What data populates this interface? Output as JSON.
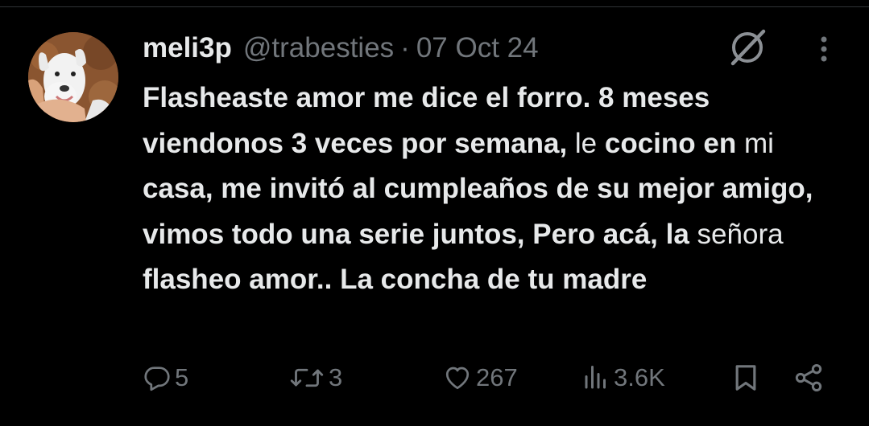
{
  "tweet": {
    "author": {
      "display_name": "meli3p",
      "handle": "@trabesties",
      "avatar_icon": "puppy-avatar"
    },
    "separator": "·",
    "date": "07 Oct 24",
    "text_segments": [
      {
        "text": "Flasheaste amor me dice el forro. 8 meses viendonos 3 veces por semana, ",
        "bold": true
      },
      {
        "text": "le ",
        "bold": false
      },
      {
        "text": "cocino en ",
        "bold": true
      },
      {
        "text": "mi ",
        "bold": false
      },
      {
        "text": "casa, me invitó al  cumpleaños de su mejor  amigo, vimos todo una serie juntos, Pero acá, la ",
        "bold": true
      },
      {
        "text": "señora ",
        "bold": false
      },
      {
        "text": "flasheo amor.. La concha de tu madre",
        "bold": true
      }
    ],
    "actions": {
      "replies": "5",
      "reposts": "3",
      "likes": "267",
      "views": "3.6K"
    },
    "icons": {
      "grok": "grok-slash-icon",
      "more": "more-vertical-icon",
      "reply": "reply-icon",
      "repost": "repost-icon",
      "like": "heart-icon",
      "views": "views-bar-icon",
      "bookmark": "bookmark-icon",
      "share": "share-icon"
    },
    "colors": {
      "background": "#000000",
      "text_primary": "#e7e9ea",
      "text_secondary": "#71767b",
      "divider": "#2f3336"
    }
  }
}
